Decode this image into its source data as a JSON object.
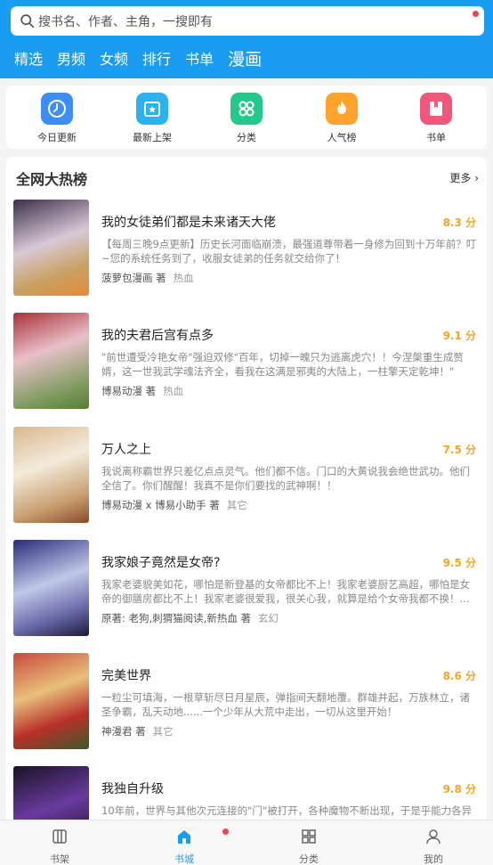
{
  "search": {
    "placeholder": "搜书名、作者、主角，一搜即有"
  },
  "channels": [
    {
      "label": "精选"
    },
    {
      "label": "男频"
    },
    {
      "label": "女频"
    },
    {
      "label": "排行"
    },
    {
      "label": "书单"
    },
    {
      "label": "漫画",
      "active": true
    }
  ],
  "quick": [
    {
      "label": "今日更新",
      "icon": "clock-icon",
      "color": "#3a8ef6"
    },
    {
      "label": "最新上架",
      "icon": "star-box-icon",
      "color": "#2ab3f0"
    },
    {
      "label": "分类",
      "icon": "grid-icon",
      "color": "#22c98a"
    },
    {
      "label": "人气榜",
      "icon": "flame-icon",
      "color": "#ffa22b"
    },
    {
      "label": "书单",
      "icon": "book-icon",
      "color": "#f2567a"
    }
  ],
  "hot": {
    "title": "全网大热榜",
    "more": "更多",
    "books": [
      {
        "title": "我的女徒弟们都是未来诸天大佬",
        "score": "8.3 分",
        "desc": "【每周三晚9点更新】历史长河面临崩溃，最强道尊带着一身修为回到十万年前？叮~您的系统任务到了，收服女徒弟的任务就交给你了！",
        "author": "菠萝包漫画 著",
        "genre": "热血",
        "cover": [
          "#5a4a6a",
          "#d7c9d8",
          "#e8a04a"
        ]
      },
      {
        "title": "我的夫君后宫有点多",
        "score": "9.1 分",
        "desc": "\"前世遭受冷艳女帝\"强迫双修\"百年，切掉一魄只为逃离虎穴！！今涅槃重生成赘婿，这一世我武学魂法齐全，看我在这满是邪夷的大陆上，一柱擎天定乾坤！\"",
        "author": "博易动漫 著",
        "genre": "热血",
        "cover": [
          "#b73a4a",
          "#e6b7c0",
          "#6a8a4a"
        ]
      },
      {
        "title": "万人之上",
        "score": "7.5 分",
        "desc": "我说离称霸世界只差亿点点灵气。他们都不信。门口的大黄说我会绝世武功。他们全信了。你们醒醒！我真不是你们要找的武神啊！！",
        "author": "博易动漫 x 博易小助手 著",
        "genre": "其它",
        "cover": [
          "#e0c8a0",
          "#f4e9d7",
          "#8a5a3a"
        ]
      },
      {
        "title": "我家娘子竟然是女帝?",
        "score": "9.5 分",
        "desc": "我家老婆貌美如花，哪怕是新登基的女帝都比不上！我家老婆厨艺高超，哪怕是女帝的御膳房都比不上！我家老婆很爱我，很关心我，就算是给个女帝我都不换！...",
        "author": "原著: 老狗,刺猬猫阅读,新热血 著",
        "genre": "玄幻",
        "cover": [
          "#3a3a8a",
          "#c8d0e8",
          "#2a2a4a"
        ]
      },
      {
        "title": "完美世界",
        "score": "8.6 分",
        "desc": "一粒尘可填海，一根草斩尽日月星辰，弹指间天翻地覆。群雄并起，万族林立，诸圣争霸，乱天动地......一个少年从大荒中走出，一切从这里开始！",
        "author": "神漫君 著",
        "genre": "其它",
        "cover": [
          "#b84a3a",
          "#e8c07a",
          "#4a6a3a"
        ]
      },
      {
        "title": "我独自升级",
        "score": "9.8 分",
        "desc": "10年前，世界与其他次元连接的\"门\"被打开，各种魔物不断出现，于是乎能力各异",
        "author": "",
        "genre": "",
        "cover": [
          "#2a1a3a",
          "#8a4ac0",
          "#1a1a2a"
        ]
      }
    ]
  },
  "nav": [
    {
      "label": "书架",
      "icon": "bookshelf-icon"
    },
    {
      "label": "书城",
      "icon": "home-icon",
      "active": true
    },
    {
      "label": "分类",
      "icon": "category-icon"
    },
    {
      "label": "我的",
      "icon": "user-icon"
    }
  ]
}
